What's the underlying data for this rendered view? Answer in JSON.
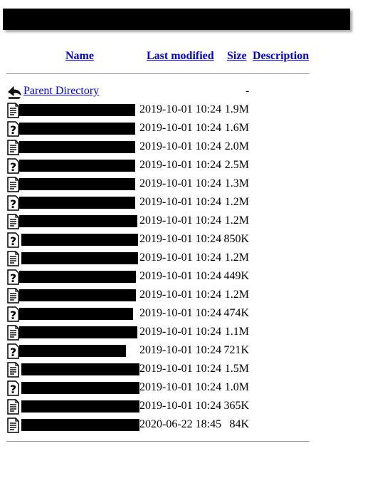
{
  "header": {
    "name": "Name",
    "last_modified": "Last modified",
    "size": "Size",
    "description": "Description"
  },
  "parent": {
    "label": "Parent Directory",
    "size": "-"
  },
  "rows": [
    {
      "icon": "text-file-icon",
      "modified": "2019-10-01 10:24",
      "size": "1.9M"
    },
    {
      "icon": "unknown-file-icon",
      "modified": "2019-10-01 10:24",
      "size": "1.6M"
    },
    {
      "icon": "text-file-icon",
      "modified": "2019-10-01 10:24",
      "size": "2.0M"
    },
    {
      "icon": "unknown-file-icon",
      "modified": "2019-10-01 10:24",
      "size": "2.5M"
    },
    {
      "icon": "text-file-icon",
      "modified": "2019-10-01 10:24",
      "size": "1.3M"
    },
    {
      "icon": "unknown-file-icon",
      "modified": "2019-10-01 10:24",
      "size": "1.2M"
    },
    {
      "icon": "text-file-icon",
      "modified": "2019-10-01 10:24",
      "size": "1.2M"
    },
    {
      "icon": "unknown-file-icon",
      "modified": "2019-10-01 10:24",
      "size": "850K"
    },
    {
      "icon": "text-file-icon",
      "modified": "2019-10-01 10:24",
      "size": "1.2M"
    },
    {
      "icon": "unknown-file-icon",
      "modified": "2019-10-01 10:24",
      "size": "449K"
    },
    {
      "icon": "text-file-icon",
      "modified": "2019-10-01 10:24",
      "size": "1.2M"
    },
    {
      "icon": "unknown-file-icon",
      "modified": "2019-10-01 10:24",
      "size": "474K"
    },
    {
      "icon": "text-file-icon",
      "modified": "2019-10-01 10:24",
      "size": "1.1M"
    },
    {
      "icon": "unknown-file-icon",
      "modified": "2019-10-01 10:24",
      "size": "721K"
    },
    {
      "icon": "text-file-icon",
      "modified": "2019-10-01 10:24",
      "size": "1.5M"
    },
    {
      "icon": "unknown-file-icon",
      "modified": "2019-10-01 10:24",
      "size": "1.0M"
    },
    {
      "icon": "text-file-icon",
      "modified": "2019-10-01 10:24",
      "size": "365K"
    },
    {
      "icon": "text-file-icon",
      "modified": "2020-06-22 18:45",
      "size": "84K"
    }
  ]
}
